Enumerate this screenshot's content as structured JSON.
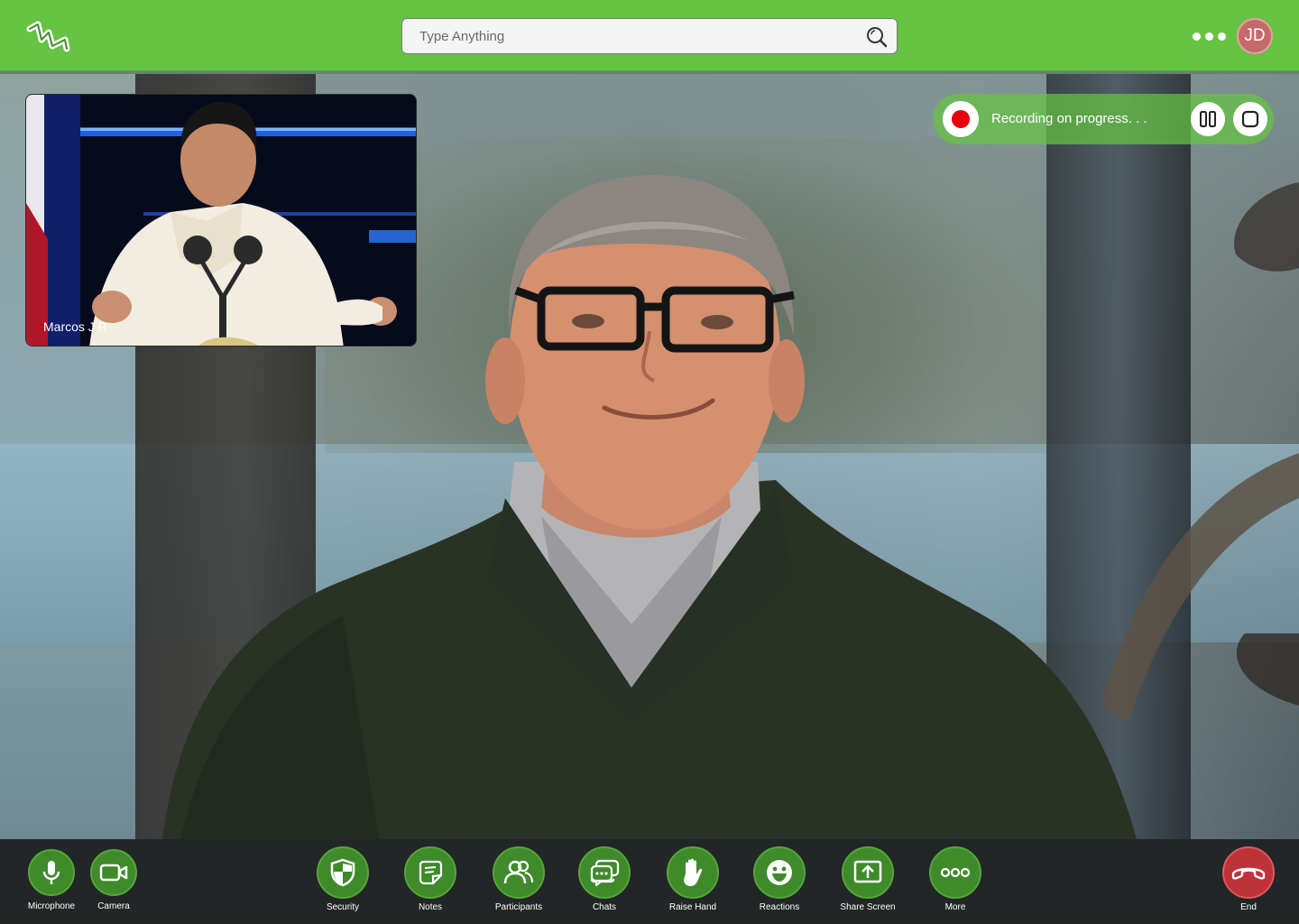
{
  "header": {
    "logo_icon": "logo-icon",
    "search": {
      "placeholder": "Type Anything",
      "icon": "search-icon"
    },
    "more_icon": "more-horizontal-icon",
    "avatar_initials": "JD"
  },
  "pip": {
    "participant_name": "Marcos J.R"
  },
  "recording": {
    "status_text": "Recording on progress. . .",
    "indicator_color": "#e8000f",
    "pause_icon": "pause-icon",
    "stop_icon": "stop-icon"
  },
  "toolbar": {
    "left": [
      {
        "label": "Microphone",
        "icon": "microphone-icon"
      },
      {
        "label": "Camera",
        "icon": "camera-icon"
      }
    ],
    "center": [
      {
        "label": "Security",
        "icon": "shield-icon"
      },
      {
        "label": "Notes",
        "icon": "notes-icon"
      },
      {
        "label": "Participants",
        "icon": "participants-icon"
      },
      {
        "label": "Chats",
        "icon": "chat-icon"
      },
      {
        "label": "Raise Hand",
        "icon": "hand-icon"
      },
      {
        "label": "Reactions",
        "icon": "smiley-icon"
      },
      {
        "label": "Share Screen",
        "icon": "share-screen-icon"
      },
      {
        "label": "More",
        "icon": "more-icon"
      }
    ],
    "end": {
      "label": "End",
      "icon": "hang-up-icon"
    }
  },
  "colors": {
    "brand_green": "#66c344",
    "button_green": "#3f8a2a",
    "end_red": "#c0323a",
    "avatar_bg": "#c46a6a"
  }
}
